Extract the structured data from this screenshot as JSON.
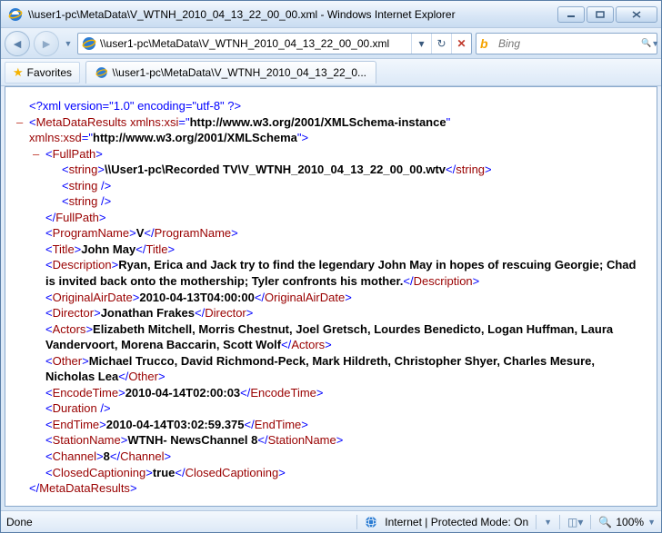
{
  "window": {
    "title": "\\\\user1-pc\\MetaData\\V_WTNH_2010_04_13_22_00_00.xml - Windows Internet Explorer"
  },
  "nav": {
    "address": "\\\\user1-pc\\MetaData\\V_WTNH_2010_04_13_22_00_00.xml",
    "search_placeholder": "Bing"
  },
  "fav": {
    "label": "Favorites",
    "tab_title": "\\\\user1-pc\\MetaData\\V_WTNH_2010_04_13_22_0..."
  },
  "xml": {
    "declaration": "<?xml version=\"1.0\" encoding=\"utf-8\" ?>",
    "root_tag": "MetaDataResults",
    "xsi_attr": "xmlns:xsi",
    "xsi_val": "http://www.w3.org/2001/XMLSchema-instance",
    "xsd_attr": "xmlns:xsd",
    "xsd_val": "http://www.w3.org/2001/XMLSchema",
    "fullpath_tag": "FullPath",
    "string_tag": "string",
    "fullpath_value": "\\\\User1-pc\\Recorded TV\\V_WTNH_2010_04_13_22_00_00.wtv",
    "program_tag": "ProgramName",
    "program_val": "V",
    "title_tag": "Title",
    "title_val": "John May",
    "desc_tag": "Description",
    "desc_val": "Ryan, Erica and Jack try to find the legendary John May in hopes of rescuing Georgie; Chad is invited back onto the mothership; Tyler confronts his mother.",
    "oad_tag": "OriginalAirDate",
    "oad_val": "2010-04-13T04:00:00",
    "director_tag": "Director",
    "director_val": "Jonathan Frakes",
    "actors_tag": "Actors",
    "actors_val": "Elizabeth Mitchell, Morris Chestnut, Joel Gretsch, Lourdes Benedicto, Logan Huffman, Laura Vandervoort, Morena Baccarin, Scott Wolf",
    "other_tag": "Other",
    "other_val": "Michael Trucco, David Richmond-Peck, Mark Hildreth, Christopher Shyer, Charles Mesure, Nicholas Lea",
    "encode_tag": "EncodeTime",
    "encode_val": "2010-04-14T02:00:03",
    "duration_tag": "Duration",
    "end_tag": "EndTime",
    "end_val": "2010-04-14T03:02:59.375",
    "station_tag": "StationName",
    "station_val": "WTNH- NewsChannel 8",
    "channel_tag": "Channel",
    "channel_val": "8",
    "cc_tag": "ClosedCaptioning",
    "cc_val": "true"
  },
  "status": {
    "left": "Done",
    "zone": "Internet | Protected Mode: On",
    "zoom": "100%"
  }
}
